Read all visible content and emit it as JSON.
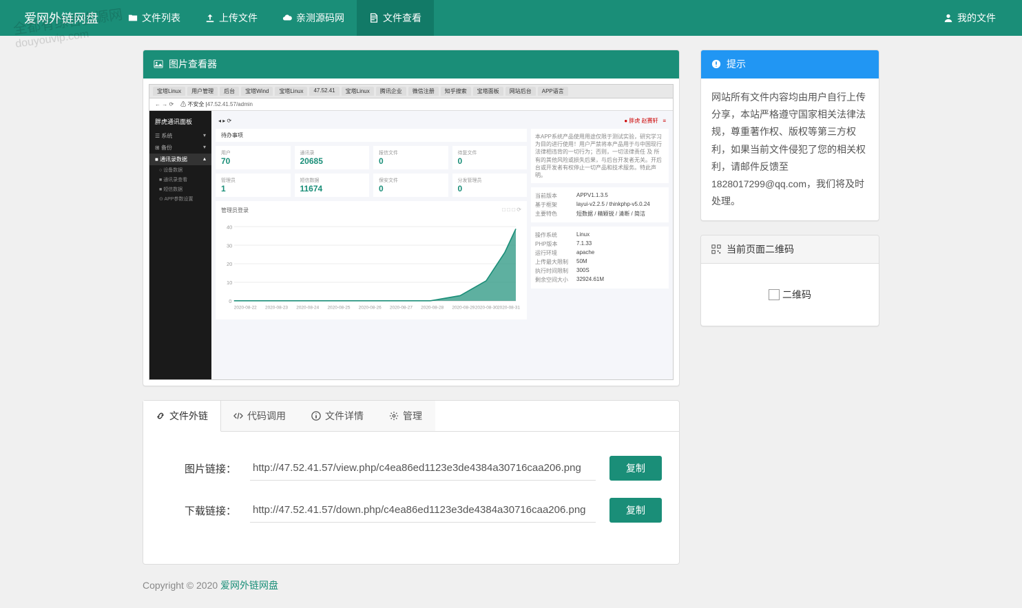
{
  "brand": "爱网外链网盘",
  "nav": {
    "file_list": "文件列表",
    "upload": "上传文件",
    "source": "亲测源码网",
    "view_file": "文件查看",
    "my_files": "我的文件"
  },
  "viewer_panel_title": "图片查看器",
  "notice": {
    "title": "提示",
    "body": "网站所有文件内容均由用户自行上传分享，本站严格遵守国家相关法律法规，尊重著作权、版权等第三方权利，如果当前文件侵犯了您的相关权利，请邮件反馈至 1828017299@qq.com，我们将及时处理。"
  },
  "qrcode": {
    "title": "当前页面二维码",
    "alt": "二维码"
  },
  "tabs": {
    "file_link": "文件外链",
    "code_call": "代码调用",
    "file_detail": "文件详情",
    "manage": "管理"
  },
  "links": {
    "image_label": "图片链接：",
    "image_url": "http://47.52.41.57/view.php/c4ea86ed1123e3de4384a30716caa206.png",
    "download_label": "下载链接：",
    "download_url": "http://47.52.41.57/down.php/c4ea86ed1123e3de4384a30716caa206.png",
    "copy": "复制"
  },
  "footer": {
    "copyright": "Copyright © 2020 ",
    "link": "爱网外链网盘"
  },
  "watermark": {
    "line1": "全都有综合资源网",
    "line2": "douyouvip.com"
  },
  "dashboard": {
    "url": "47.52.41.57/admin",
    "brand": "胖虎通讯面板",
    "top_right": "胖虎 赵赛轩",
    "menu": {
      "system": "系统",
      "backup": "备份",
      "contacts_data": "通讯录数据",
      "device_data": "设备数据",
      "contacts_view": "通讯录查看",
      "sms_data": "短信数据",
      "app_params": "APP参数设置"
    },
    "todo_title": "待办事项",
    "stats": [
      {
        "label": "用户",
        "value": "70"
      },
      {
        "label": "通讯录",
        "value": "20685"
      },
      {
        "label": "报信文件",
        "value": "0"
      },
      {
        "label": "待复文件",
        "value": "0"
      },
      {
        "label": "管理员",
        "value": "1"
      },
      {
        "label": "短信数据",
        "value": "11674"
      },
      {
        "label": "保安文件",
        "value": "0"
      },
      {
        "label": "分发管理员",
        "value": "0"
      }
    ],
    "chart_title": "管理员登录",
    "notice_text": "本APP系统产品使用用途仅限于测试实验，研究学习为目的进行使用！用户严禁将本产品用于与中国现行法律相违背的一切行为；否则，一切法律责任 及 所有的其他风险或损失后果，与后台开发者无关。开后台或开发者有权停止一切产品和技术服务。特此声明。",
    "version": {
      "current_label": "当前版本",
      "current_val": "APPV1.1.3.5",
      "based_label": "基于框架",
      "based_val": "layui-v2.2.5 / thinkphp-v5.0.24",
      "features_label": "主要特色",
      "features_val": "短数据 / 精颖锐 / 清断 / 简洁"
    },
    "env": {
      "os_label": "操作系统",
      "os_val": "Linux",
      "php_label": "PHP版本",
      "php_val": "7.1.33",
      "runtime_label": "运行环境",
      "runtime_val": "apache",
      "upload_label": "上传最大限制",
      "upload_val": "50M",
      "exec_label": "执行时间限制",
      "exec_val": "300S",
      "disk_label": "剩余空间大小",
      "disk_val": "32924.61M"
    },
    "chart_x": [
      "2020-08-22",
      "2020-08-23",
      "2020-08-24",
      "2020-08-25",
      "2020-08-26",
      "2020-08-27",
      "2020-08-28",
      "2020-08-29",
      "2020-08-30",
      "2020-08-31"
    ]
  }
}
